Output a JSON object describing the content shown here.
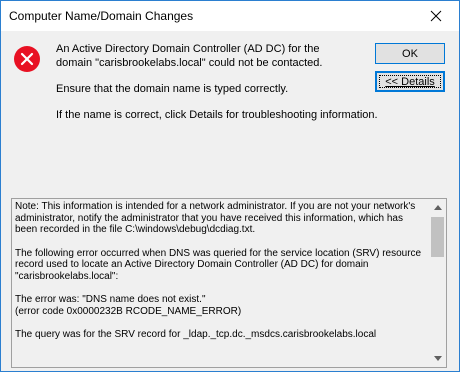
{
  "window": {
    "title": "Computer Name/Domain Changes"
  },
  "message": {
    "line1": "An Active Directory Domain Controller (AD DC) for the domain \"carisbrookelabs.local\" could not be contacted.",
    "line2": "Ensure that the domain name is typed correctly.",
    "line3": "If the name is correct, click Details for troubleshooting information."
  },
  "buttons": {
    "ok": "OK",
    "details": "<< Details"
  },
  "details": {
    "paragraphs": [
      "Note: This information is intended for a network administrator. If you are not your network's administrator, notify the administrator that you have received this information, which has been recorded in the file C:\\windows\\debug\\dcdiag.txt.",
      "The following error occurred when DNS was queried for the service location (SRV) resource record used to locate an Active Directory Domain Controller (AD DC) for domain \"carisbrookelabs.local\":",
      "The error was: \"DNS name does not exist.\"",
      "(error code 0x0000232B RCODE_NAME_ERROR)",
      "The query was for the SRV record for _ldap._tcp.dc._msdcs.carisbrookelabs.local"
    ]
  },
  "icons": {
    "error": "error-icon",
    "close": "close-icon"
  },
  "colors": {
    "error_red": "#e81123",
    "accent": "#0078d7",
    "dialog_bg": "#f0f0f0"
  }
}
